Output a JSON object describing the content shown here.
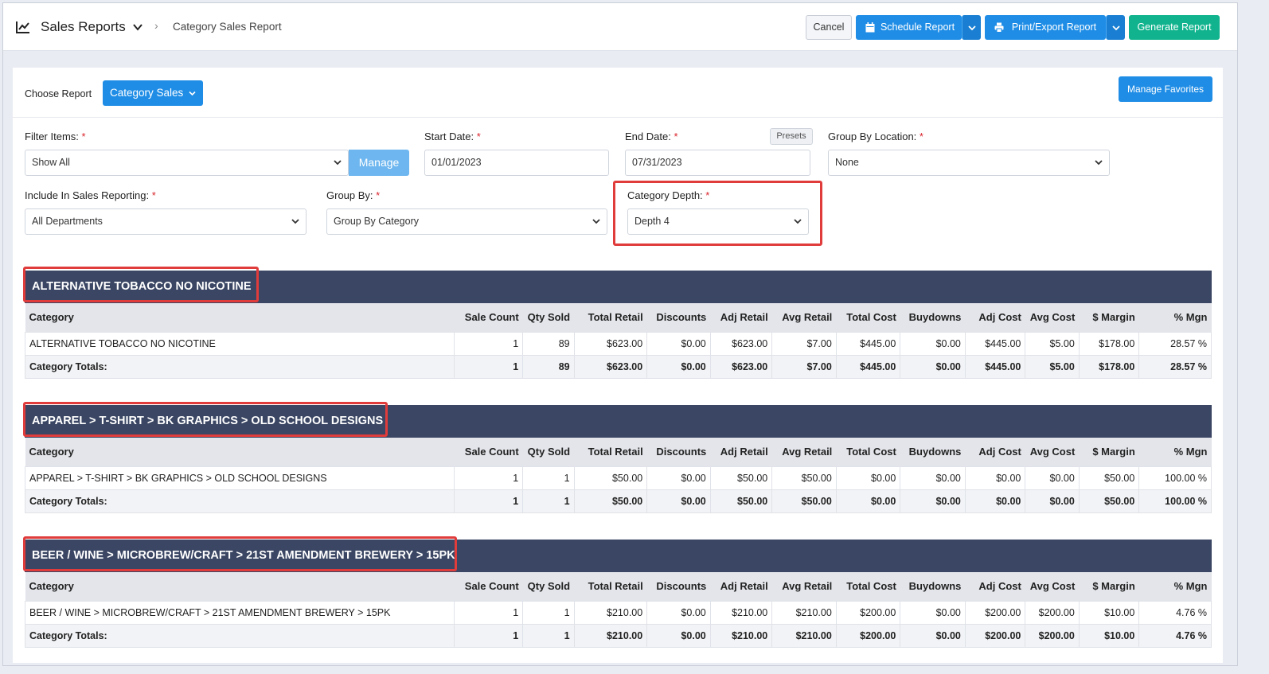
{
  "header": {
    "title": "Sales Reports",
    "breadcrumb": "Category Sales Report",
    "buttons": {
      "cancel": "Cancel",
      "schedule": "Schedule Report",
      "print": "Print/Export Report",
      "generate": "Generate Report"
    }
  },
  "toolbar": {
    "choose_label": "Choose Report",
    "report_button": "Category Sales",
    "favorites_button": "Manage Favorites"
  },
  "filters": {
    "filter_items": {
      "label": "Filter Items:",
      "value": "Show All",
      "manage": "Manage"
    },
    "start_date": {
      "label": "Start Date:",
      "value": "01/01/2023"
    },
    "end_date": {
      "label": "End Date:",
      "value": "07/31/2023",
      "presets": "Presets"
    },
    "group_by_location": {
      "label": "Group By Location:",
      "value": "None"
    },
    "include_sales": {
      "label": "Include In Sales Reporting:",
      "value": "All Departments"
    },
    "group_by": {
      "label": "Group By:",
      "value": "Group By Category"
    },
    "category_depth": {
      "label": "Category Depth:",
      "value": "Depth 4"
    },
    "required_mark": "*"
  },
  "columns": [
    "Category",
    "Sale Count",
    "Qty Sold",
    "Total Retail",
    "Discounts",
    "Adj Retail",
    "Avg Retail",
    "Total Cost",
    "Buydowns",
    "Adj Cost",
    "Avg Cost",
    "$ Margin",
    "% Mgn"
  ],
  "sections": [
    {
      "title": "ALTERNATIVE TOBACCO NO NICOTINE",
      "row": [
        "ALTERNATIVE TOBACCO NO NICOTINE",
        "1",
        "89",
        "$623.00",
        "$0.00",
        "$623.00",
        "$7.00",
        "$445.00",
        "$0.00",
        "$445.00",
        "$5.00",
        "$178.00",
        "28.57 %"
      ],
      "totals": [
        "Category Totals:",
        "1",
        "89",
        "$623.00",
        "$0.00",
        "$623.00",
        "$7.00",
        "$445.00",
        "$0.00",
        "$445.00",
        "$5.00",
        "$178.00",
        "28.57 %"
      ]
    },
    {
      "title": "APPAREL > T-SHIRT > BK GRAPHICS > OLD SCHOOL DESIGNS",
      "row": [
        "APPAREL > T-SHIRT > BK GRAPHICS > OLD SCHOOL DESIGNS",
        "1",
        "1",
        "$50.00",
        "$0.00",
        "$50.00",
        "$50.00",
        "$0.00",
        "$0.00",
        "$0.00",
        "$0.00",
        "$50.00",
        "100.00 %"
      ],
      "totals": [
        "Category Totals:",
        "1",
        "1",
        "$50.00",
        "$0.00",
        "$50.00",
        "$50.00",
        "$0.00",
        "$0.00",
        "$0.00",
        "$0.00",
        "$50.00",
        "100.00 %"
      ]
    },
    {
      "title": "BEER / WINE > MICROBREW/CRAFT > 21ST AMENDMENT BREWERY > 15PK",
      "row": [
        "BEER / WINE > MICROBREW/CRAFT > 21ST AMENDMENT BREWERY > 15PK",
        "1",
        "1",
        "$210.00",
        "$0.00",
        "$210.00",
        "$210.00",
        "$200.00",
        "$0.00",
        "$200.00",
        "$200.00",
        "$10.00",
        "4.76 %"
      ],
      "totals": [
        "Category Totals:",
        "1",
        "1",
        "$210.00",
        "$0.00",
        "$210.00",
        "$210.00",
        "$200.00",
        "$0.00",
        "$200.00",
        "$200.00",
        "$10.00",
        "4.76 %"
      ]
    }
  ],
  "colors": {
    "section_header": "#3a4663",
    "primary_button": "#1f8de6",
    "generate_button": "#10b38d",
    "highlight": "#e03c3c",
    "required": "#d9252c"
  }
}
